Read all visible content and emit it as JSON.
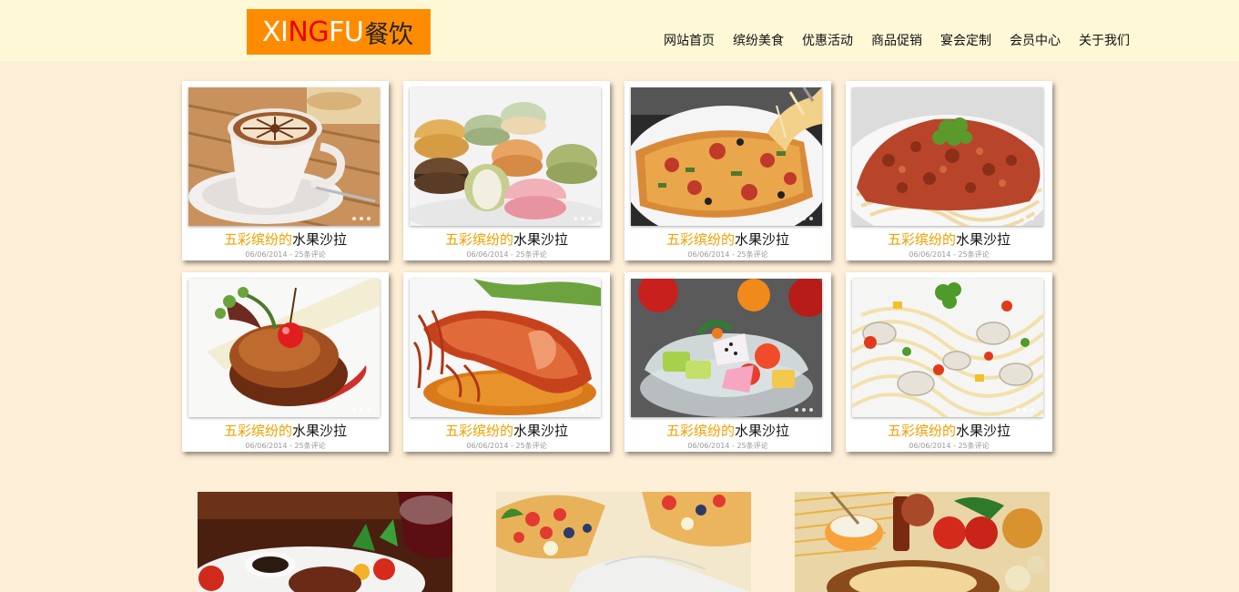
{
  "logo": {
    "part1": "XI",
    "part2": "NG",
    "part3": "FU",
    "part4": "餐饮"
  },
  "nav": [
    "网站首页",
    "缤纷美食",
    "优惠活动",
    "商品促销",
    "宴会定制",
    "会员中心",
    "关于我们"
  ],
  "cards": [
    {
      "title_hl": "五彩缤纷的",
      "title": "水果沙拉",
      "meta": "06/06/2014 - 25条评论"
    },
    {
      "title_hl": "五彩缤纷的",
      "title": "水果沙拉",
      "meta": "06/06/2014 - 25条评论"
    },
    {
      "title_hl": "五彩缤纷的",
      "title": "水果沙拉",
      "meta": "06/06/2014 - 25条评论"
    },
    {
      "title_hl": "五彩缤纷的",
      "title": "水果沙拉",
      "meta": "06/06/2014 - 25条评论"
    },
    {
      "title_hl": "五彩缤纷的",
      "title": "水果沙拉",
      "meta": "06/06/2014 - 25条评论"
    },
    {
      "title_hl": "五彩缤纷的",
      "title": "水果沙拉",
      "meta": "06/06/2014 - 25条评论"
    },
    {
      "title_hl": "五彩缤纷的",
      "title": "水果沙拉",
      "meta": "06/06/2014 - 25条评论"
    },
    {
      "title_hl": "五彩缤纷的",
      "title": "水果沙拉",
      "meta": "06/06/2014 - 25条评论"
    }
  ],
  "colors": {
    "header_bg": "#fef8d6",
    "page_bg": "#fdeed7",
    "logo_bg": "#ff8c00",
    "logo_accent": "#e80000",
    "highlight": "#f0a000"
  },
  "icons": [
    "coffee-photo",
    "macaron-photo",
    "pizza-photo",
    "bolognese-photo",
    "steak-photo",
    "lobster-photo",
    "fruit-salad-photo",
    "seafood-pasta-photo",
    "steak-dinner-photo",
    "berry-tart-photo",
    "pasta-ingredients-photo"
  ]
}
